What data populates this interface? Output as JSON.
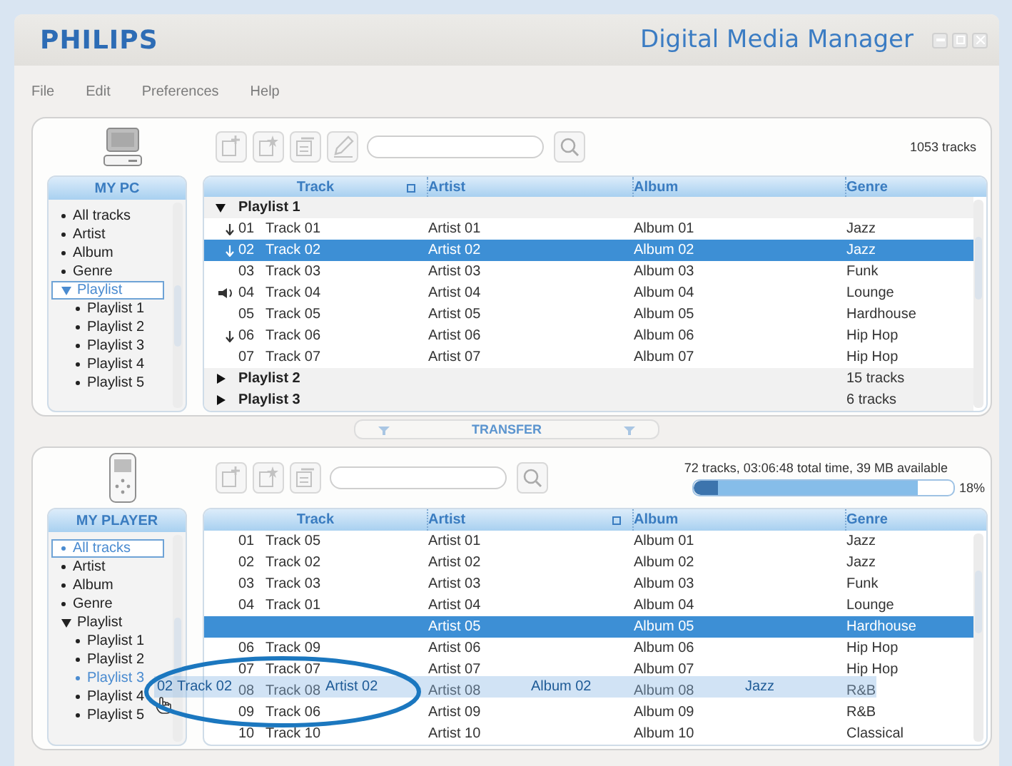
{
  "window": {
    "logo": "PHILIPS",
    "title": "Digital Media Manager"
  },
  "menu": [
    "File",
    "Edit",
    "Preferences",
    "Help"
  ],
  "pc_panel": {
    "summary": "1053 tracks",
    "toolbar": [
      {
        "kind": "add"
      },
      {
        "kind": "add-star"
      },
      {
        "kind": "remove"
      },
      {
        "kind": "edit"
      }
    ],
    "sidebar": {
      "title": "MY PC",
      "items": [
        {
          "label": "All tracks",
          "selected": false
        },
        {
          "label": "Artist",
          "selected": false
        },
        {
          "label": "Album",
          "selected": false
        },
        {
          "label": "Genre",
          "selected": false
        },
        {
          "label": "Playlist",
          "selected": true,
          "expanded": true,
          "children": [
            {
              "label": "Playlist 1",
              "selected": false
            },
            {
              "label": "Playlist 2",
              "selected": false
            },
            {
              "label": "Playlist 3",
              "selected": false
            },
            {
              "label": "Playlist 4",
              "selected": false
            },
            {
              "label": "Playlist 5",
              "selected": false
            }
          ]
        }
      ]
    },
    "table": {
      "columns": [
        {
          "label": "Track",
          "sorted": true
        },
        {
          "label": "Artist",
          "sorted": false
        },
        {
          "label": "Album",
          "sorted": false
        },
        {
          "label": "Genre",
          "sorted": false
        }
      ],
      "rows": [
        {
          "kind": "group",
          "label": "Playlist 1",
          "expanded": true
        },
        {
          "kind": "track",
          "queued": true,
          "playing": false,
          "number": "01",
          "title": "Track 01",
          "artist": "Artist 01",
          "album": "Album 01",
          "genre": "Jazz",
          "selected": false
        },
        {
          "kind": "track",
          "queued": true,
          "playing": false,
          "number": "02",
          "title": "Track 02",
          "artist": "Artist 02",
          "album": "Album 02",
          "genre": "Jazz",
          "selected": true
        },
        {
          "kind": "track",
          "queued": false,
          "playing": false,
          "number": "03",
          "title": "Track 03",
          "artist": "Artist 03",
          "album": "Album 03",
          "genre": "Funk",
          "selected": false
        },
        {
          "kind": "track",
          "queued": false,
          "playing": true,
          "number": "04",
          "title": "Track 04",
          "artist": "Artist 04",
          "album": "Album 04",
          "genre": "Lounge",
          "selected": false
        },
        {
          "kind": "track",
          "queued": false,
          "playing": false,
          "number": "05",
          "title": "Track 05",
          "artist": "Artist 05",
          "album": "Album 05",
          "genre": "Hardhouse",
          "selected": false
        },
        {
          "kind": "track",
          "queued": true,
          "playing": false,
          "number": "06",
          "title": "Track 06",
          "artist": "Artist 06",
          "album": "Album 06",
          "genre": "Hip Hop",
          "selected": false
        },
        {
          "kind": "track",
          "queued": false,
          "playing": false,
          "number": "07",
          "title": "Track 07",
          "artist": "Artist 07",
          "album": "Album 07",
          "genre": "Hip Hop",
          "selected": false
        },
        {
          "kind": "group",
          "label": "Playlist 2",
          "expanded": false,
          "count": "15 tracks"
        },
        {
          "kind": "group",
          "label": "Playlist 3",
          "expanded": false,
          "count": "6 tracks"
        }
      ]
    }
  },
  "transfer": {
    "label": "TRANSFER"
  },
  "player_panel": {
    "toolbar": [
      {
        "kind": "add"
      },
      {
        "kind": "add-star"
      },
      {
        "kind": "remove"
      }
    ],
    "storage": {
      "info": "72 tracks, 03:06:48 total time, 39 MB available",
      "level": 0.86,
      "reading": "18%"
    },
    "sidebar": {
      "title": "MY PLAYER",
      "items": [
        {
          "label": "All tracks",
          "selected": true,
          "highlighted": false
        },
        {
          "label": "Artist",
          "selected": false,
          "highlighted": false
        },
        {
          "label": "Album",
          "selected": false,
          "highlighted": false
        },
        {
          "label": "Genre",
          "selected": false,
          "highlighted": false
        },
        {
          "label": "Playlist",
          "selected": false,
          "highlighted": false,
          "expanded": true,
          "children": [
            {
              "label": "Playlist 1",
              "selected": false,
              "highlighted": false
            },
            {
              "label": "Playlist 2",
              "selected": false,
              "highlighted": false
            },
            {
              "label": "Playlist 3",
              "selected": false,
              "highlighted": true
            },
            {
              "label": "Playlist 4",
              "selected": false,
              "highlighted": false
            },
            {
              "label": "Playlist 5",
              "selected": false,
              "highlighted": false
            }
          ]
        }
      ]
    },
    "table": {
      "columns": [
        {
          "label": "Track",
          "sorted": false
        },
        {
          "label": "Artist",
          "sorted": true
        },
        {
          "label": "Album",
          "sorted": false
        },
        {
          "label": "Genre",
          "sorted": false
        }
      ],
      "rows": [
        {
          "kind": "track",
          "number": "01",
          "title": "Track 05",
          "artist": "Artist 01",
          "album": "Album 01",
          "genre": "Jazz",
          "selected": false
        },
        {
          "kind": "track",
          "number": "02",
          "title": "Track 02",
          "artist": "Artist 02",
          "album": "Album 02",
          "genre": "Jazz",
          "selected": false
        },
        {
          "kind": "track",
          "number": "03",
          "title": "Track 03",
          "artist": "Artist 03",
          "album": "Album 03",
          "genre": "Funk",
          "selected": false
        },
        {
          "kind": "track",
          "number": "04",
          "title": "Track 01",
          "artist": "Artist 04",
          "album": "Album 04",
          "genre": "Lounge",
          "selected": false
        },
        {
          "kind": "track",
          "artist": "Artist 05",
          "album": "Album 05",
          "genre": "Hardhouse",
          "selected": true
        },
        {
          "kind": "track",
          "number": "06",
          "title": "Track 09",
          "artist": "Artist 06",
          "album": "Album 06",
          "genre": "Hip Hop",
          "selected": false
        },
        {
          "kind": "track",
          "number": "07",
          "title": "Track 07",
          "artist": "Artist 07",
          "album": "Album 07",
          "genre": "Hip Hop",
          "selected": false
        },
        {
          "kind": "track",
          "number": "08",
          "title": "Track 08",
          "artist": "Artist 08",
          "album": "Album 08",
          "genre": "R&B",
          "selected": false
        },
        {
          "kind": "track",
          "number": "09",
          "title": "Track 06",
          "artist": "Artist 09",
          "album": "Album 09",
          "genre": "R&B",
          "selected": false
        },
        {
          "kind": "track",
          "number": "10",
          "title": "Track 10",
          "artist": "Artist 10",
          "album": "Album 10",
          "genre": "Classical",
          "selected": false
        }
      ]
    }
  },
  "drag": {
    "cells": [
      "02",
      "Track 02",
      "Artist 02",
      "Album 02",
      "Jazz"
    ]
  },
  "annotation": {
    "kind": "ellipse"
  }
}
